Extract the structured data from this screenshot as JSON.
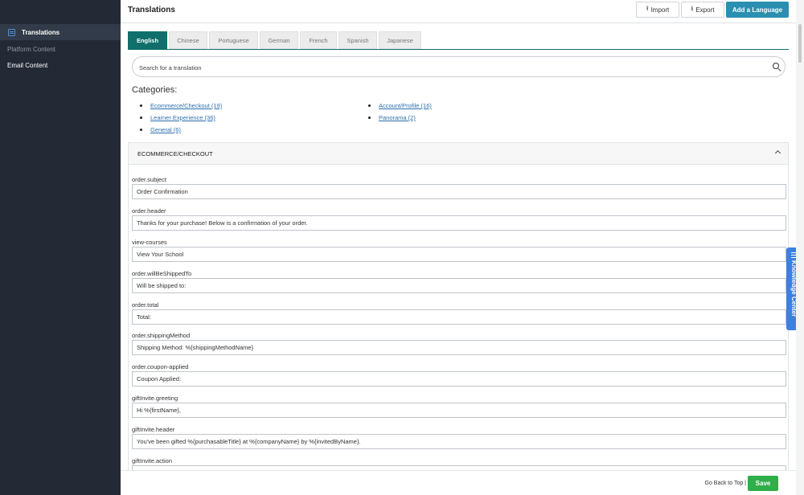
{
  "sidebar": {
    "items": [
      {
        "label": "Translations",
        "active": true
      },
      {
        "label": "Platform Content"
      },
      {
        "label": "Email Content"
      }
    ]
  },
  "header": {
    "title": "Translations",
    "import_label": "Import",
    "export_label": "Export",
    "add_language_label": "Add a Language"
  },
  "tabs": [
    "English",
    "Chinese",
    "Portuguese",
    "German",
    "French",
    "Spanish",
    "Japanese"
  ],
  "search": {
    "placeholder": "Search for a translation"
  },
  "categories": {
    "title": "Categories:",
    "left": [
      "Ecommerce/Checkout (19)",
      "Learner Experience (36)",
      "General (6)"
    ],
    "right": [
      "Account/Profile (16)",
      "Panorama (2)"
    ]
  },
  "panel": {
    "title": "ECOMMERCE/CHECKOUT",
    "fields": [
      {
        "key": "order.subject",
        "value": "Order Confirmation"
      },
      {
        "key": "order.header",
        "value": "Thanks for your purchase! Below is a confirmation of your order."
      },
      {
        "key": "view-courses",
        "value": "View Your School"
      },
      {
        "key": "order.willBeShippedTo",
        "value": "Will be shipped to:"
      },
      {
        "key": "order.total",
        "value": "Total:"
      },
      {
        "key": "order.shippingMethod",
        "value": "Shipping Method: %{shippingMethodName}"
      },
      {
        "key": "order.coupon-applied",
        "value": "Coupon Applied:"
      },
      {
        "key": "giftInvite.greeting",
        "value": "Hi %{firstName},"
      },
      {
        "key": "giftInvite.header",
        "value": "You've been gifted %{purchasableTitle} at %{companyName} by %{invitedByName}."
      },
      {
        "key": "giftInvite.action",
        "value": ""
      }
    ]
  },
  "knowledge_center": {
    "label": "Knowledge Center"
  },
  "footer": {
    "back_to_top": "Go Back to Top |",
    "save_label": "Save"
  },
  "colors": {
    "sidebar": "#232a35",
    "tab_active": "#0f6f6a",
    "primary": "#2a8fb0",
    "save": "#2fae49",
    "knowledge": "#3f7fe0",
    "link": "#2c6fad"
  }
}
